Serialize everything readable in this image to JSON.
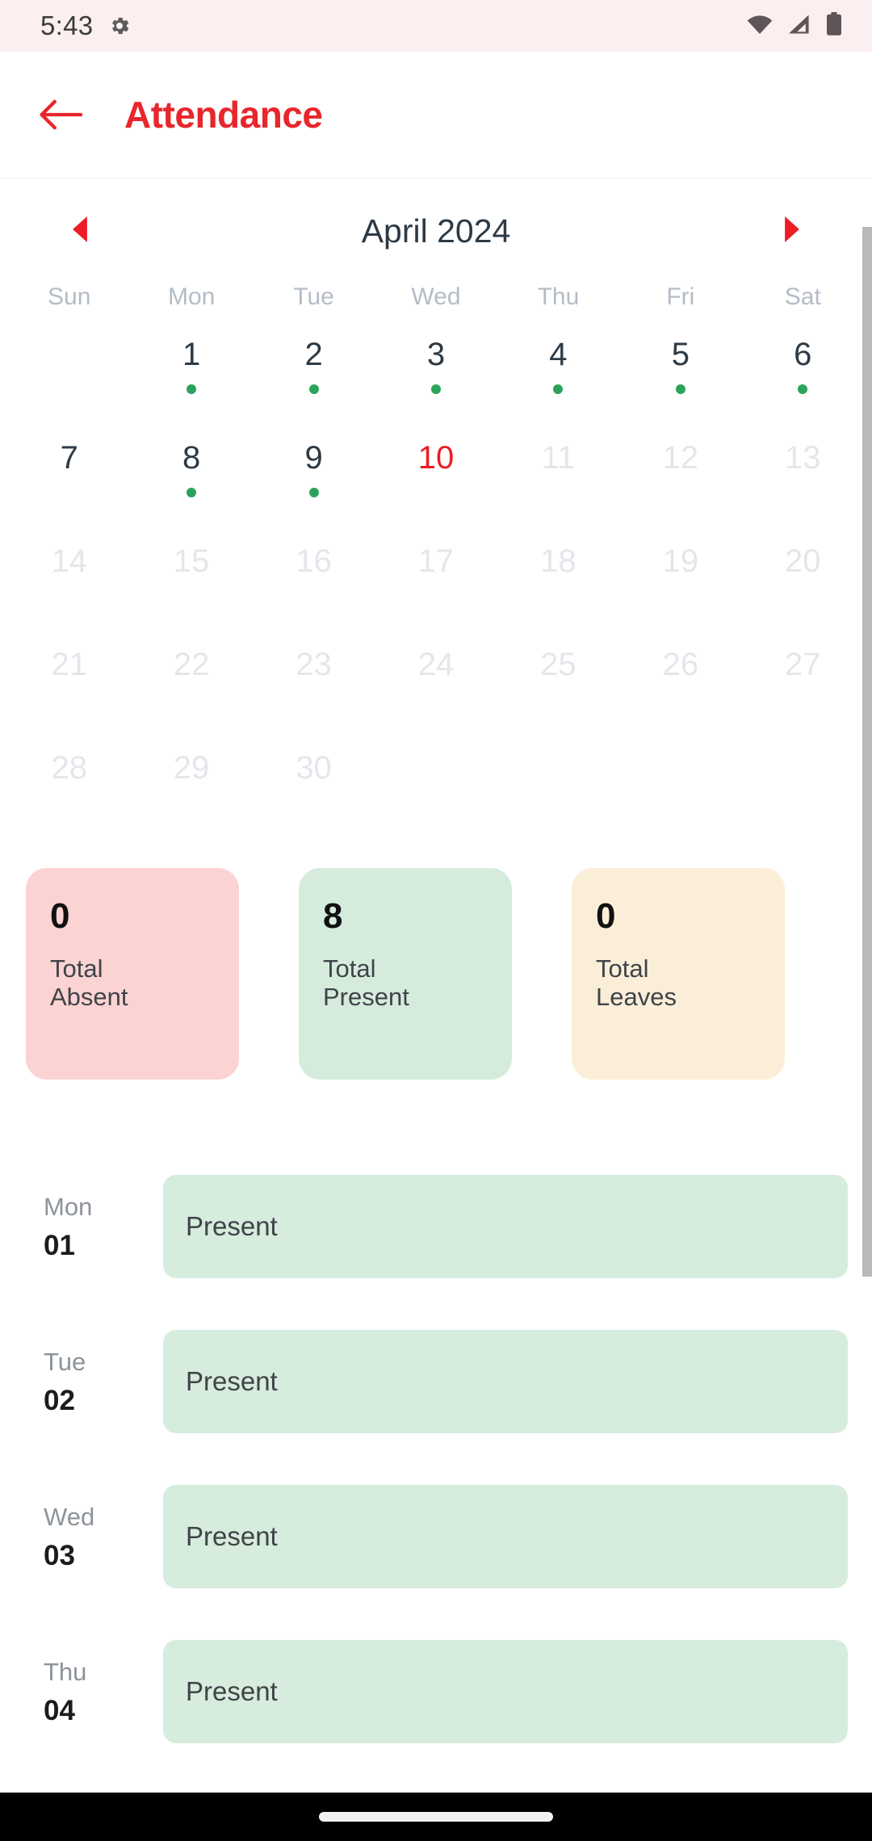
{
  "status_bar": {
    "time": "5:43",
    "icons": [
      "gear-icon",
      "wifi-icon",
      "cellular-icon",
      "battery-icon"
    ],
    "background": "#fcefef"
  },
  "app_bar": {
    "back_icon": "back-arrow-icon",
    "title": "Attendance",
    "title_color": "#e8262c"
  },
  "calendar": {
    "prev_icon": "chevron-left-icon",
    "next_icon": "chevron-right-icon",
    "month_label": "April 2024",
    "weekdays": [
      "Sun",
      "Mon",
      "Tue",
      "Wed",
      "Thu",
      "Fri",
      "Sat"
    ],
    "today": 10,
    "dot_color": "#2ba35a",
    "weeks": [
      [
        {
          "day": "",
          "state": "blank",
          "dot": false
        },
        {
          "day": "1",
          "state": "active",
          "dot": true
        },
        {
          "day": "2",
          "state": "active",
          "dot": true
        },
        {
          "day": "3",
          "state": "active",
          "dot": true
        },
        {
          "day": "4",
          "state": "active",
          "dot": true
        },
        {
          "day": "5",
          "state": "active",
          "dot": true
        },
        {
          "day": "6",
          "state": "active",
          "dot": true
        }
      ],
      [
        {
          "day": "7",
          "state": "active",
          "dot": false
        },
        {
          "day": "8",
          "state": "active",
          "dot": true
        },
        {
          "day": "9",
          "state": "active",
          "dot": true
        },
        {
          "day": "10",
          "state": "today",
          "dot": false
        },
        {
          "day": "11",
          "state": "muted",
          "dot": false
        },
        {
          "day": "12",
          "state": "muted",
          "dot": false
        },
        {
          "day": "13",
          "state": "muted",
          "dot": false
        }
      ],
      [
        {
          "day": "14",
          "state": "muted",
          "dot": false
        },
        {
          "day": "15",
          "state": "muted",
          "dot": false
        },
        {
          "day": "16",
          "state": "muted",
          "dot": false
        },
        {
          "day": "17",
          "state": "muted",
          "dot": false
        },
        {
          "day": "18",
          "state": "muted",
          "dot": false
        },
        {
          "day": "19",
          "state": "muted",
          "dot": false
        },
        {
          "day": "20",
          "state": "muted",
          "dot": false
        }
      ],
      [
        {
          "day": "21",
          "state": "muted",
          "dot": false
        },
        {
          "day": "22",
          "state": "muted",
          "dot": false
        },
        {
          "day": "23",
          "state": "muted",
          "dot": false
        },
        {
          "day": "24",
          "state": "muted",
          "dot": false
        },
        {
          "day": "25",
          "state": "muted",
          "dot": false
        },
        {
          "day": "26",
          "state": "muted",
          "dot": false
        },
        {
          "day": "27",
          "state": "muted",
          "dot": false
        }
      ],
      [
        {
          "day": "28",
          "state": "muted",
          "dot": false
        },
        {
          "day": "29",
          "state": "muted",
          "dot": false
        },
        {
          "day": "30",
          "state": "muted",
          "dot": false
        },
        {
          "day": "",
          "state": "blank",
          "dot": false
        },
        {
          "day": "",
          "state": "blank",
          "dot": false
        },
        {
          "day": "",
          "state": "blank",
          "dot": false
        },
        {
          "day": "",
          "state": "blank",
          "dot": false
        }
      ]
    ]
  },
  "summary": [
    {
      "value": "0",
      "label": "Total Absent",
      "kind": "absent",
      "color": "#fbd3d3"
    },
    {
      "value": "8",
      "label": "Total Present",
      "kind": "present",
      "color": "#d5ecdd"
    },
    {
      "value": "0",
      "label": "Total Leaves",
      "kind": "leaves",
      "color": "#fbeed8"
    }
  ],
  "attendance_list": [
    {
      "weekday": "Mon",
      "day": "01",
      "status": "Present",
      "kind": "present"
    },
    {
      "weekday": "Tue",
      "day": "02",
      "status": "Present",
      "kind": "present"
    },
    {
      "weekday": "Wed",
      "day": "03",
      "status": "Present",
      "kind": "present"
    },
    {
      "weekday": "Thu",
      "day": "04",
      "status": "Present",
      "kind": "present"
    }
  ],
  "nav_bar": {
    "gesture_pill": "home-indicator"
  }
}
